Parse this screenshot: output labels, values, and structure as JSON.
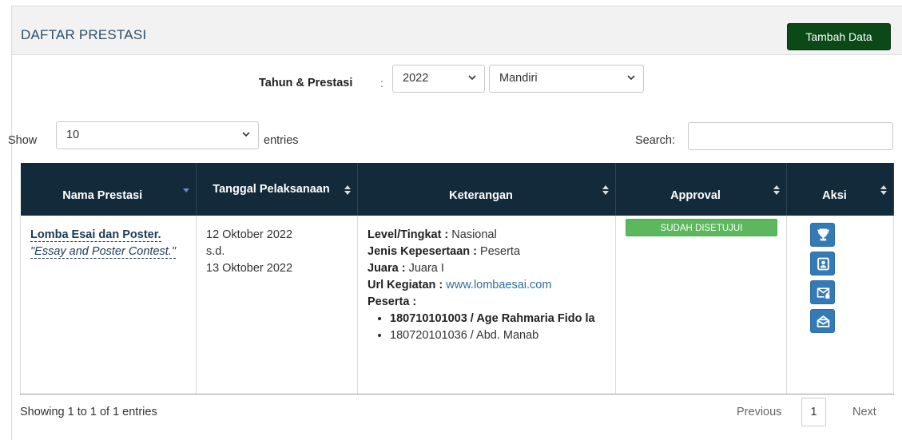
{
  "panel": {
    "title": "DAFTAR PRESTASI",
    "add_button": "Tambah Data"
  },
  "filter": {
    "label": "Tahun & Prestasi",
    "colon": ":",
    "year": "2022",
    "type": "Mandiri"
  },
  "length": {
    "show_label": "Show",
    "value": "10",
    "entries_label": "entries"
  },
  "search": {
    "label": "Search:",
    "value": ""
  },
  "table": {
    "headers": [
      "Nama Prestasi",
      "Tanggal Pelaksanaan",
      "Keterangan",
      "Approval",
      "Aksi"
    ],
    "rows": [
      {
        "name": "Lomba Esai dan Poster.",
        "name_en": "Essay and Poster Contest.",
        "date_start": "12 Oktober 2022",
        "date_sep": "s.d.",
        "date_end": "13 Oktober 2022",
        "level_label": "Level/Tingkat :",
        "level_value": "Nasional",
        "jenis_label": "Jenis Kepesertaan :",
        "jenis_value": "Peserta",
        "juara_label": "Juara :",
        "juara_value": "Juara I",
        "url_label": "Url Kegiatan :",
        "url_value": "www.lombaesai.com",
        "peserta_label": "Peserta :",
        "peserta": [
          "180710101003 / Age Rahmaria Fido la",
          "180720101036 / Abd. Manab"
        ],
        "approval": "SUDAH DISETUJUI"
      }
    ]
  },
  "actions": {
    "icons": [
      "trophy-icon",
      "id-card-icon",
      "mail-icon",
      "envelope-open-icon"
    ]
  },
  "footer": {
    "info": "Showing 1 to 1 of 1 entries",
    "previous": "Previous",
    "page": "1",
    "next": "Next"
  },
  "colors": {
    "header_bg": "#132a3a",
    "add_button_bg": "#0b4a16",
    "approved_badge": "#5cb85c",
    "action_button": "#337ab7"
  }
}
